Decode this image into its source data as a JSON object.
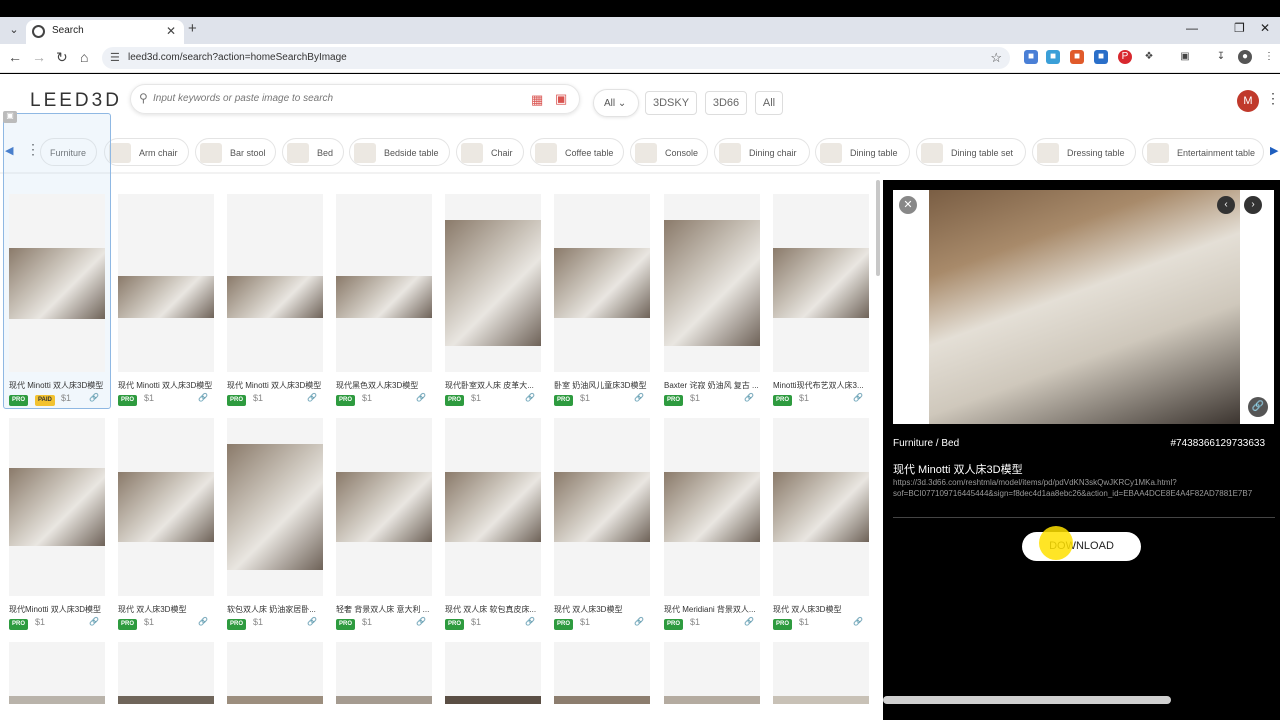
{
  "browser": {
    "tab_title": "Search",
    "url": "leed3d.com/search?action=homeSearchByImage"
  },
  "header": {
    "logo": "LEED3D",
    "search_placeholder": "Input keywords or paste image to search",
    "select_all": "All",
    "filters": [
      "3DSKY",
      "3D66",
      "All"
    ],
    "avatar_letter": "M"
  },
  "categories": [
    "Furniture",
    "Arm chair",
    "Bar stool",
    "Bed",
    "Bedside table",
    "Chair",
    "Coffee table",
    "Console",
    "Dining chair",
    "Dining table",
    "Dining table set",
    "Dressing table",
    "Entertainment table"
  ],
  "grid": {
    "row1": [
      {
        "name": "现代 Minotti 双人床3D模型",
        "price": "$1",
        "paid": "PAID"
      },
      {
        "name": "现代 Minotti 双人床3D模型",
        "price": "$1"
      },
      {
        "name": "现代 Minotti 双人床3D模型",
        "price": "$1"
      },
      {
        "name": "现代黑色双人床3D模型",
        "price": "$1"
      },
      {
        "name": "现代卧室双人床 皮革大...",
        "price": "$1"
      },
      {
        "name": "卧室 奶油风儿童床3D模型",
        "price": "$1"
      },
      {
        "name": "Baxter 诧寂 奶油风 复古 ...",
        "price": "$1"
      },
      {
        "name": "Minotti现代布艺双人床3...",
        "price": "$1"
      }
    ],
    "row2": [
      {
        "name": "现代Minotti 双人床3D模型",
        "price": "$1"
      },
      {
        "name": "现代 双人床3D模型",
        "price": "$1"
      },
      {
        "name": "软包双人床 奶油家居卧...",
        "price": "$1"
      },
      {
        "name": "轻奢 背景双人床 意大利 ...",
        "price": "$1"
      },
      {
        "name": "现代 双人床 软包真皮床...",
        "price": "$1"
      },
      {
        "name": "现代 双人床3D模型",
        "price": "$1"
      },
      {
        "name": "现代 Meridiani 背景双人...",
        "price": "$1"
      },
      {
        "name": "现代 双人床3D模型",
        "price": "$1"
      }
    ],
    "pro_label": "PRO"
  },
  "panel": {
    "breadcrumb": "Furniture / Bed",
    "id": "#7438366129733633",
    "title": "现代 Minotti 双人床3D模型",
    "url_line1": "https://3d.3d66.com/reshtmla/model/items/pd/pdVdKN3skQwJKRCy1MKa.html?",
    "url_line2": "sof=BCI077109716445444&sign=f8dec4d1aa8ebc26&action_id=EBAA4DCE8E4A4F82AD7881E7B7",
    "download": "DOWNLOAD"
  }
}
